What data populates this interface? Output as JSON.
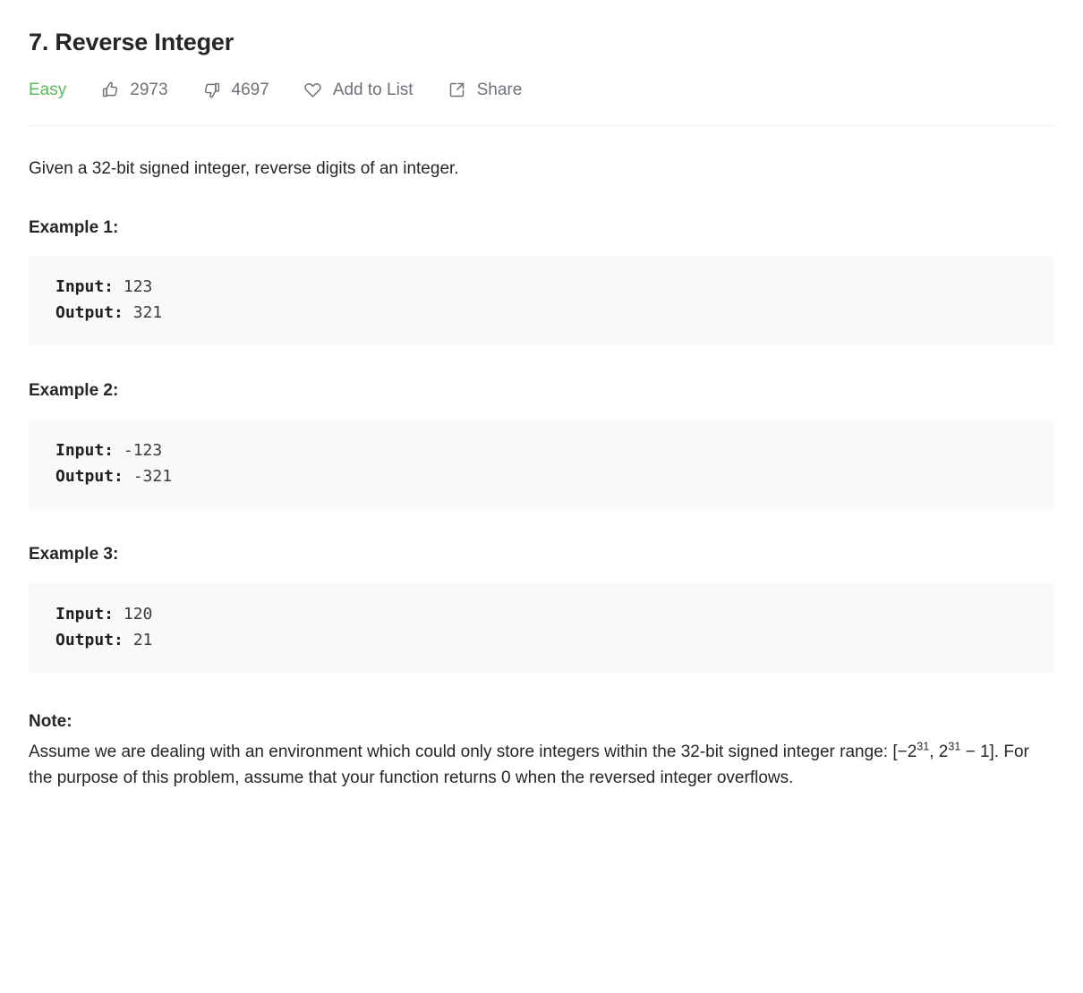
{
  "problem": {
    "title": "7. Reverse Integer",
    "difficulty": "Easy",
    "difficulty_color": "#5cb85c",
    "likes": "2973",
    "dislikes": "4697",
    "add_to_list_label": "Add to List",
    "share_label": "Share",
    "icons": {
      "like": "thumbs-up-icon",
      "dislike": "thumbs-down-icon",
      "favorite": "heart-icon",
      "share": "share-icon"
    }
  },
  "description": "Given a 32-bit signed integer, reverse digits of an integer.",
  "examples": [
    {
      "heading": "Example 1:",
      "input_key": "Input:",
      "input_value": "123",
      "output_key": "Output:",
      "output_value": "321"
    },
    {
      "heading": "Example 2:",
      "input_key": "Input:",
      "input_value": "-123",
      "output_key": "Output:",
      "output_value": "-321"
    },
    {
      "heading": "Example 3:",
      "input_key": "Input:",
      "input_value": "120",
      "output_key": "Output:",
      "output_value": "21"
    }
  ],
  "note": {
    "heading": "Note:",
    "part1": "Assume we are dealing with an environment which could only store integers within the 32-bit signed integer range: [−2",
    "exp1": "31",
    "part2": ", 2",
    "exp2": "31",
    "part3": " − 1]. For the purpose of this problem, assume that your function returns 0 when the reversed integer overflows.",
    "full_text": "Assume we are dealing with an environment which could only store integers within the 32-bit signed integer range: [−2^31, 2^31 − 1]. For the purpose of this problem, assume that your function returns 0 when the reversed integer overflows."
  }
}
